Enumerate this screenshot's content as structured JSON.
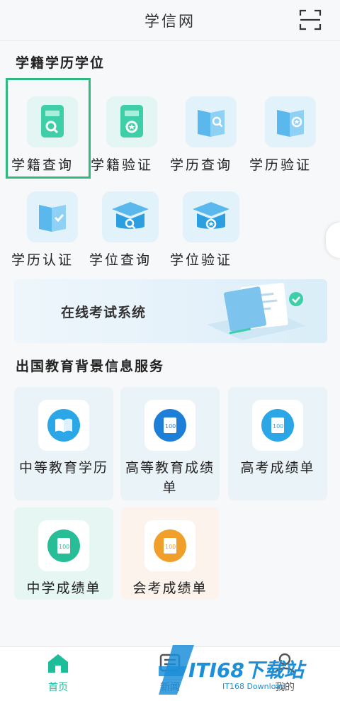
{
  "header": {
    "title": "学信网",
    "scan_icon": "scan-icon"
  },
  "section_xueji": {
    "title": "学籍学历学位",
    "items": [
      {
        "label": "学籍查询",
        "icon": "book-search-icon"
      },
      {
        "label": "学籍验证",
        "icon": "book-verify-icon"
      },
      {
        "label": "学历查询",
        "icon": "certificate-search-icon"
      },
      {
        "label": "学历验证",
        "icon": "certificate-verify-icon"
      },
      {
        "label": "学历认证",
        "icon": "certificate-check-icon"
      },
      {
        "label": "学位查询",
        "icon": "cap-search-icon"
      },
      {
        "label": "学位验证",
        "icon": "cap-verify-icon"
      }
    ]
  },
  "banner": {
    "label": "在线考试系统"
  },
  "section_abroad": {
    "title": "出国教育背景信息服务",
    "cards": [
      {
        "label": "中等教育学历",
        "icon": "book-open-icon"
      },
      {
        "label": "高等教育成绩单",
        "icon": "score-sheet-icon"
      },
      {
        "label": "高考成绩单",
        "icon": "score-sheet-icon"
      },
      {
        "label": "中学成绩单",
        "icon": "score-sheet-icon"
      },
      {
        "label": "会考成绩单",
        "icon": "score-sheet-icon"
      }
    ]
  },
  "bottom_nav": {
    "tabs": [
      {
        "label": "首页",
        "icon": "home-icon"
      },
      {
        "label": "新闻",
        "icon": "news-icon"
      },
      {
        "label": "我的",
        "icon": "profile-icon"
      }
    ]
  },
  "watermark": {
    "main": "ITI68下载站",
    "sub": "IT168 Download"
  },
  "colors": {
    "accent": "#1ebd9a",
    "blue": "#2b9fe0",
    "highlight": "#2fba7e",
    "orange": "#f0a02a"
  }
}
